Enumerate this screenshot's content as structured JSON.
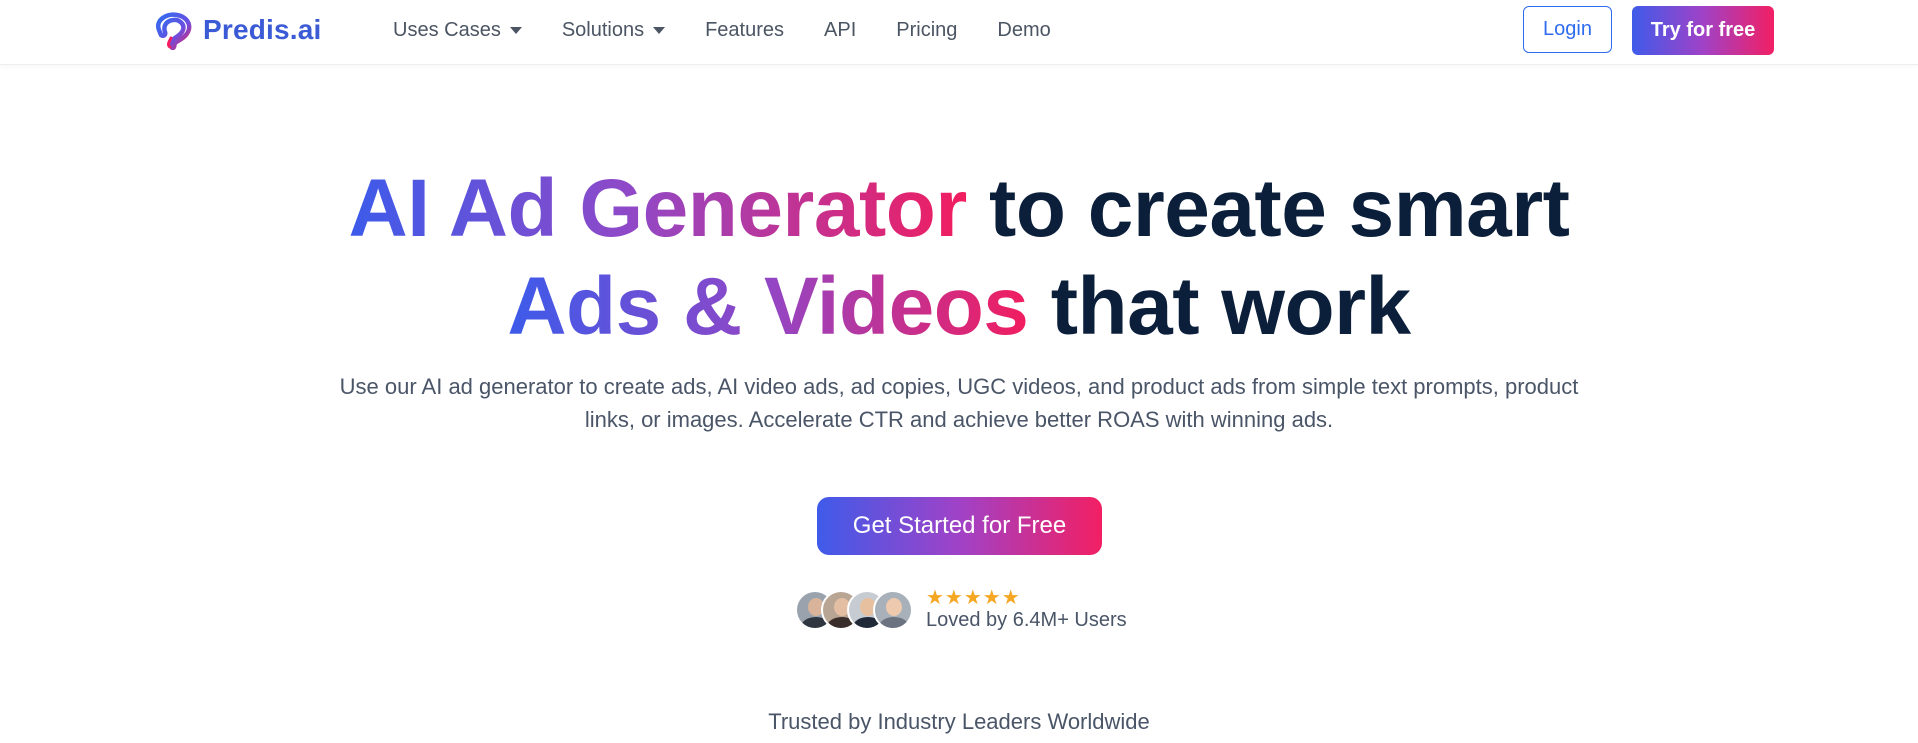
{
  "header": {
    "logo_text": "Predis.ai",
    "nav": [
      {
        "label": "Uses Cases",
        "has_dropdown": true
      },
      {
        "label": "Solutions",
        "has_dropdown": true
      },
      {
        "label": "Features",
        "has_dropdown": false
      },
      {
        "label": "API",
        "has_dropdown": false
      },
      {
        "label": "Pricing",
        "has_dropdown": false
      },
      {
        "label": "Demo",
        "has_dropdown": false
      }
    ],
    "login_label": "Login",
    "try_label": "Try for free"
  },
  "hero": {
    "title_grad_1": "AI Ad Generator",
    "title_dark_1": " to create smart",
    "title_grad_2": "Ads & Videos",
    "title_dark_2": " that work",
    "subtitle": "Use our AI ad generator to create ads, AI video ads, ad copies, UGC videos, and product ads from simple text prompts, product links, or images. Accelerate CTR and achieve better ROAS with winning ads.",
    "cta_label": "Get Started for Free",
    "rating_stars": 5,
    "stars_text": "★★★★★",
    "loved_text": "Loved by 6.4M+ Users"
  },
  "trusted_text": "Trusted by Industry Leaders Worldwide",
  "colors": {
    "brand_blue": "#3b5bd6",
    "gradient_start": "#3f5be9",
    "gradient_mid": "#a042c7",
    "gradient_end": "#f21f63",
    "title_dark": "#0b1f3a",
    "star": "#f5a623"
  }
}
